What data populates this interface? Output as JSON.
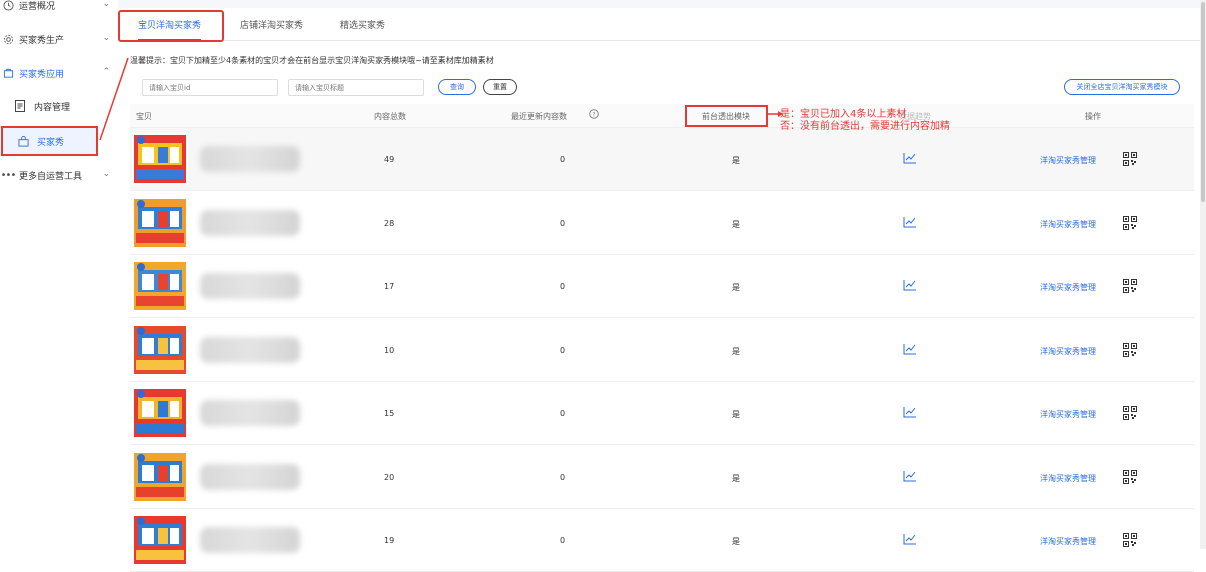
{
  "sidebar": {
    "items": [
      {
        "label": "运营概况",
        "icon": "clock-icon"
      },
      {
        "label": "买家秀生产",
        "icon": "gear-icon"
      },
      {
        "label": "买家秀应用",
        "icon": "app-icon"
      },
      {
        "label": "内容管理",
        "icon": "document-icon"
      },
      {
        "label": "买家秀",
        "icon": "bag-icon"
      },
      {
        "label": "更多自运营工具",
        "icon": "more-icon"
      }
    ]
  },
  "tabs": [
    "宝贝洋淘买家秀",
    "店铺洋淘买家秀",
    "精选买家秀"
  ],
  "tip": "温馨提示：宝贝下加精至少4条素材的宝贝才会在前台显示宝贝洋淘买家秀模块哦~请至素材库加精素材",
  "filters": {
    "item_id_placeholder": "请输入宝贝id",
    "item_title_placeholder": "请输入宝贝标题",
    "query_label": "查询",
    "reset_label": "重置",
    "close_label": "关闭全店宝贝洋淘买家秀模块"
  },
  "table": {
    "headers": [
      "宝贝",
      "内容总数",
      "最近更新内容数",
      "前台透出模块",
      "操作"
    ],
    "trend_header": "数据趋势",
    "rows": [
      {
        "total": "49",
        "recent": "0",
        "shown": "是",
        "action": "洋淘买家秀管理"
      },
      {
        "total": "28",
        "recent": "0",
        "shown": "是",
        "action": "洋淘买家秀管理"
      },
      {
        "total": "17",
        "recent": "0",
        "shown": "是",
        "action": "洋淘买家秀管理"
      },
      {
        "total": "10",
        "recent": "0",
        "shown": "是",
        "action": "洋淘买家秀管理"
      },
      {
        "total": "15",
        "recent": "0",
        "shown": "是",
        "action": "洋淘买家秀管理"
      },
      {
        "total": "20",
        "recent": "0",
        "shown": "是",
        "action": "洋淘买家秀管理"
      },
      {
        "total": "19",
        "recent": "0",
        "shown": "是",
        "action": "洋淘买家秀管理"
      }
    ]
  },
  "annotation": {
    "line1": "是：宝贝已加入4条以上素材",
    "line2": "否：没有前台透出，需要进行内容加精"
  },
  "colors": {
    "accent": "#2a6de0",
    "annotation": "#e53935"
  }
}
